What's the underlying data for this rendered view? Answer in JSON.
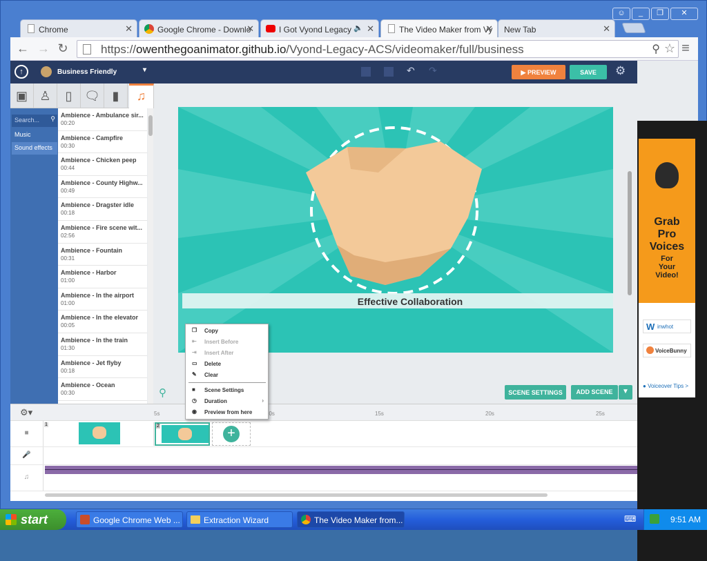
{
  "browser": {
    "tabs": [
      {
        "title": "Chrome",
        "icon": "page-icon"
      },
      {
        "title": "Google Chrome - Downlo",
        "icon": "chrome-icon"
      },
      {
        "title": "I Got Vyond Legacy",
        "icon": "youtube-icon"
      },
      {
        "title": "The Video Maker from Vy",
        "icon": "page-icon"
      },
      {
        "title": "New Tab",
        "icon": ""
      }
    ],
    "url_scheme": "https://",
    "url_host": "owenthegoanimator.github.io",
    "url_path": "/Vyond-Legacy-ACS/videomaker/full/business"
  },
  "app": {
    "theme": "Business Friendly",
    "toolbar": {
      "preview": "PREVIEW",
      "save": "SAVE"
    },
    "sidebar": {
      "search_placeholder": "Search...",
      "items": [
        "Music",
        "Sound effects"
      ],
      "assets": [
        {
          "name": "Ambience - Ambulance sir...",
          "duration": "00:20"
        },
        {
          "name": "Ambience - Campfire",
          "duration": "00:30"
        },
        {
          "name": "Ambience - Chicken peep",
          "duration": "00:44"
        },
        {
          "name": "Ambience - County Highw...",
          "duration": "00:49"
        },
        {
          "name": "Ambience - Dragster idle",
          "duration": "00:18"
        },
        {
          "name": "Ambience - Fire scene wit...",
          "duration": "02:56"
        },
        {
          "name": "Ambience - Fountain",
          "duration": "00:31"
        },
        {
          "name": "Ambience - Harbor",
          "duration": "01:00"
        },
        {
          "name": "Ambience - In the airport",
          "duration": "01:00"
        },
        {
          "name": "Ambience - In the elevator",
          "duration": "00:05"
        },
        {
          "name": "Ambience - In the train",
          "duration": "01:30"
        },
        {
          "name": "Ambience - Jet flyby",
          "duration": "00:18"
        },
        {
          "name": "Ambience - Ocean",
          "duration": "00:30"
        }
      ]
    },
    "stage": {
      "caption": "Effective Collaboration"
    },
    "context_menu": {
      "items": [
        {
          "label": "Copy",
          "enabled": true
        },
        {
          "label": "Insert Before",
          "enabled": false
        },
        {
          "label": "Insert After",
          "enabled": false
        },
        {
          "label": "Delete",
          "enabled": true
        },
        {
          "label": "Clear",
          "enabled": true
        },
        {
          "label": "Scene Settings",
          "enabled": true
        },
        {
          "label": "Duration",
          "enabled": true
        },
        {
          "label": "Preview from here",
          "enabled": true
        }
      ]
    },
    "scene_buttons": {
      "settings": "SCENE SETTINGS",
      "add": "ADD SCENE"
    },
    "timeline": {
      "ticks": [
        "5s",
        "10s",
        "15s",
        "20s",
        "25s"
      ],
      "scenes": [
        "1",
        "2"
      ]
    },
    "ad": {
      "headline_1": "Grab",
      "headline_2": "Pro",
      "headline_3": "Voices",
      "sub_1": "For",
      "sub_2": "Your",
      "sub_3": "Video!",
      "brand_1": "inwhot",
      "brand_2": "VoiceBunny",
      "tips": "Voiceover Tips >"
    }
  },
  "taskbar": {
    "start": "start",
    "tasks": [
      "Google Chrome Web ...",
      "Extraction Wizard",
      "The Video Maker from..."
    ],
    "clock": "9:51 AM"
  },
  "colors": {
    "stage": "#2cc3b5",
    "preview": "#f0823e",
    "save": "#3bbfa7",
    "navy": "#283b62",
    "accent": "#3fb39c"
  }
}
